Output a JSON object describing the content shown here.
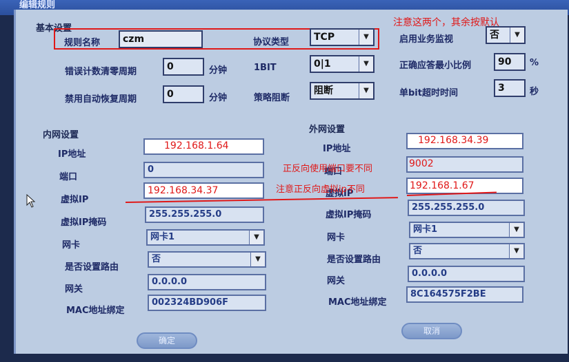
{
  "window": {
    "title": "编辑规则"
  },
  "annotation_top": "注意这两个，其余按默认",
  "basic": {
    "section": "基本设置",
    "rule_name_label": "规则名称",
    "rule_name_value": "czm",
    "protocol_label": "协议类型",
    "protocol_value": "TCP",
    "monitor_label": "启用业务监视",
    "monitor_value": "否",
    "err_period_label": "错误计数清零周期",
    "err_period_value": "0",
    "minute1": "分钟",
    "bit_label": "1BIT",
    "bit_value": "0|1",
    "min_ratio_label": "正确应答最小比例",
    "min_ratio_value": "90",
    "percent": "%",
    "disable_period_label": "禁用自动恢复周期",
    "disable_period_value": "0",
    "minute2": "分钟",
    "policy_label": "策略阻断",
    "policy_value": "阻断",
    "bit_timeout_label": "单bit超时时间",
    "bit_timeout_value": "3",
    "seconds": "秒"
  },
  "inner": {
    "section": "内网设置",
    "ip_label": "IP地址",
    "ip_value": "192.168.1.64",
    "port_label": "端口",
    "port_value": "0",
    "vip_label": "虚拟IP",
    "vip_value": "192.168.34.37",
    "mask_label": "虚拟IP掩码",
    "mask_value": "255.255.255.0",
    "nic_label": "网卡",
    "nic_value": "网卡1",
    "route_label": "是否设置路由",
    "route_value": "否",
    "gw_label": "网关",
    "gw_value": "0.0.0.0",
    "mac_label": "MAC地址绑定",
    "mac_value": "002324BD906F"
  },
  "outer": {
    "section": "外网设置",
    "ip_label": "IP地址",
    "ip_value": "192.168.34.39",
    "port_label": "端口",
    "port_value": "9002",
    "vip_label": "虚拟IP",
    "vip_value": "192.168.1.67",
    "mask_label": "虚拟IP掩码",
    "mask_value": "255.255.255.0",
    "nic_label": "网卡",
    "nic_value": "网卡1",
    "route_label": "是否设置路由",
    "route_value": "否",
    "gw_label": "网关",
    "gw_value": "0.0.0.0",
    "mac_label": "MAC地址绑定",
    "mac_value": "8C164575F2BE"
  },
  "notes": {
    "port_note": "正反向使用端口要不同",
    "vip_note": "注意正反向虚拟ip不同"
  },
  "buttons": {
    "ok": "确定",
    "cancel": "取消"
  },
  "colors": {
    "annotation": "#e01818",
    "dialog_bg": "#bccce2"
  }
}
